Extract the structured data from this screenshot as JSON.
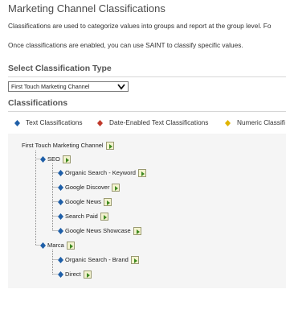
{
  "page": {
    "title": "Marketing Channel Classifications",
    "intro_1": "Classifications are used to categorize values into groups and report at the group level. Fo",
    "intro_2": "Once classifications are enabled, you can use SAINT to classify specific values."
  },
  "type_section": {
    "heading": "Select Classification Type",
    "selected_value": "First Touch Marketing Channel"
  },
  "classifications": {
    "heading": "Classifications",
    "legend": [
      {
        "label": "Text Classifications",
        "icon": "blue-diamond-icon",
        "color": "#1f5fa8"
      },
      {
        "label": "Date-Enabled Text Classifications",
        "icon": "red-diamond-icon",
        "color": "#c0392b"
      },
      {
        "label": "Numeric Classifi",
        "icon": "yellow-diamond-icon",
        "color": "#e0b400"
      }
    ],
    "tree": {
      "root": "First Touch Marketing Channel",
      "seo": "SEO",
      "seo_children": [
        "Organic Search - Keyword",
        "Google Discover",
        "Google News",
        "Search Paid",
        "Google News Showcase"
      ],
      "marca": "Marca",
      "marca_children": [
        "Organic Search - Brand",
        "Direct"
      ]
    }
  }
}
